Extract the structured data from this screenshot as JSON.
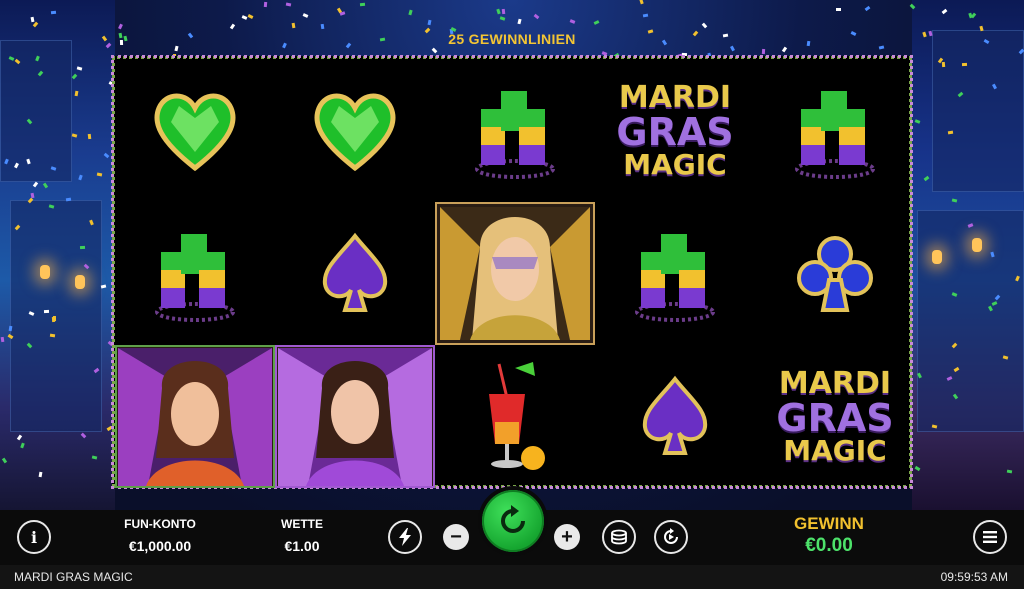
{
  "header": {
    "paylines": "25 GEWINNLINIEN"
  },
  "reels": {
    "grid": [
      [
        "green-heart",
        "green-heart",
        "shot-glasses",
        "mardi-gras-logo",
        "shot-glasses"
      ],
      [
        "shot-glasses",
        "purple-spade",
        "blonde-masked-woman",
        "shot-glasses",
        "blue-club"
      ],
      [
        "feathered-woman-green",
        "feathered-woman-purple",
        "cocktail",
        "purple-spade",
        "mardi-gras-logo"
      ]
    ],
    "logo_words": [
      "MARDI",
      "GRAS",
      "MAGIC"
    ]
  },
  "controls": {
    "info_icon": "i",
    "fun_account_label": "FUN-KONTO",
    "fun_account_value": "€1,000.00",
    "bet_label": "WETTE",
    "bet_value": "€1.00",
    "minus": "−",
    "plus": "+",
    "win_label": "GEWINN",
    "win_value": "€0.00",
    "icons": [
      "info-icon",
      "lightning-icon",
      "minus-icon",
      "spin-icon",
      "plus-icon",
      "coins-icon",
      "autoplay-icon",
      "menu-icon"
    ]
  },
  "footer": {
    "game_name": "MARDI GRAS MAGIC",
    "clock": "09:59:53 AM"
  },
  "colors": {
    "gold": "#f2c12e",
    "green": "#4de26a",
    "spin": "#22b83a"
  }
}
